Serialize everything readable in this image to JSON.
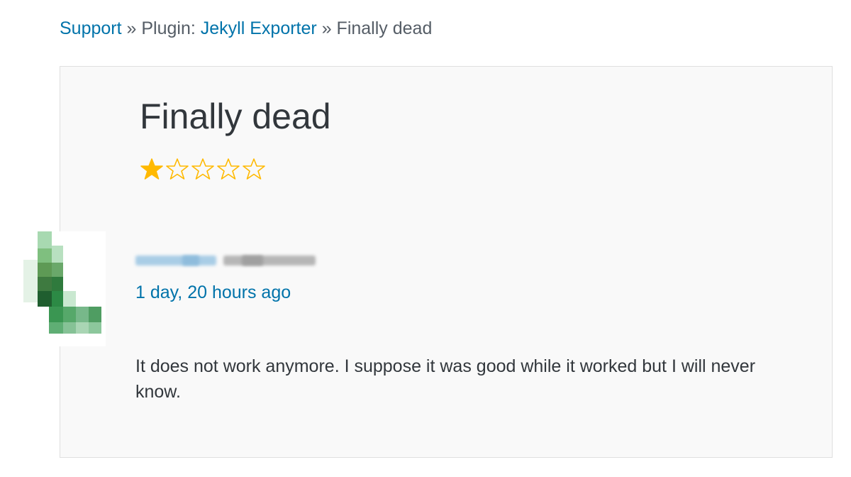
{
  "breadcrumb": {
    "support": "Support",
    "separator": "»",
    "plugin_prefix": "Plugin:",
    "plugin_name": "Jekyll Exporter",
    "current": "Finally dead"
  },
  "review": {
    "title": "Finally dead",
    "rating": 1,
    "max_rating": 5,
    "author_redacted": true,
    "timestamp": "1 day, 20 hours ago",
    "body": "It does not work anymore. I suppose it was good while it worked but I will never know."
  },
  "colors": {
    "link": "#0073aa",
    "star_filled": "#ffb900",
    "text": "#32373c"
  },
  "icons": {
    "star_filled": "star-filled-icon",
    "star_empty": "star-empty-icon"
  }
}
